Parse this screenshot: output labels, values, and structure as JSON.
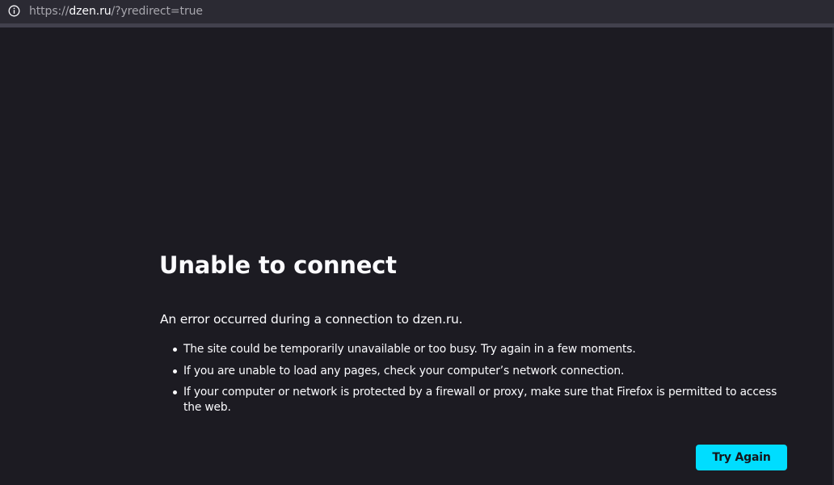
{
  "browser": {
    "url_scheme": "https://",
    "url_host": "dzen.ru",
    "url_rest": "/?yredirect=true",
    "info_icon": "info-icon"
  },
  "error_page": {
    "title": "Unable to connect",
    "intro": "An error occurred during a connection to dzen.ru.",
    "reasons": [
      "The site could be temporarily unavailable or too busy. Try again in a few moments.",
      "If you are unable to load any pages, check your computer’s network connection.",
      "If your computer or network is protected by a firewall or proxy, make sure that Firefox is permitted to access the web."
    ],
    "try_again_label": "Try Again"
  },
  "colors": {
    "background": "#1c1b22",
    "toolbar": "#2b2a33",
    "accent_button": "#00ddff",
    "text": "#fbfbfe",
    "muted_text": "#a7a6ad"
  }
}
